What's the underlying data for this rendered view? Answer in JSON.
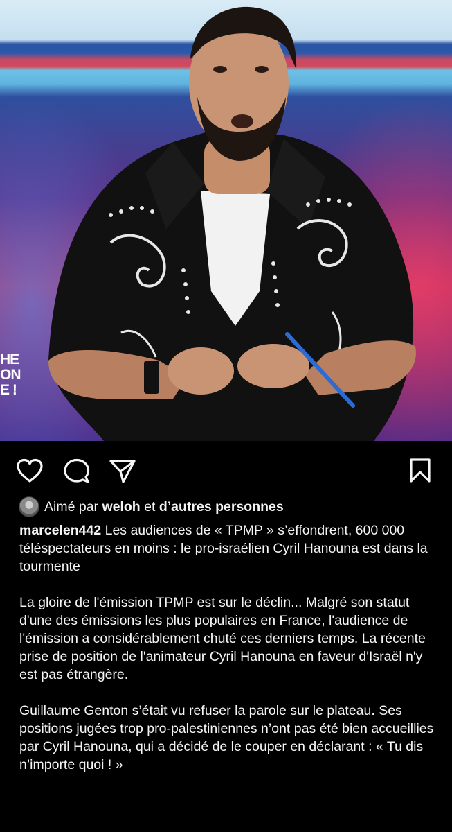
{
  "photo": {
    "logo_lines": [
      "HE",
      "ON",
      "E !"
    ]
  },
  "actions": {
    "like_icon": "heart-icon",
    "comment_icon": "comment-icon",
    "share_icon": "send-icon",
    "save_icon": "bookmark-icon"
  },
  "likes": {
    "prefix": "Aimé par",
    "user": "weloh",
    "connector": "et",
    "others": "d’autres personnes"
  },
  "caption": {
    "username": "marcelen442",
    "headline": "Les audiences de « TPMP » s’effondrent, 600 000 téléspectateurs en moins : le pro-israélien Cyril Hanouna est dans la tourmente",
    "paragraph_1": "La gloire de l'émission TPMP est sur le déclin... Malgré son statut d'une des émissions les plus populaires en France, l'audience de l'émission a considérablement chuté ces derniers temps. La récente prise de position de l'animateur Cyril Hanouna en faveur d'Israël n'y est pas étrangère.",
    "paragraph_2": "Guillaume Genton s’était vu refuser la parole sur le plateau. Ses positions jugées trop pro-palestiniennes n’ont pas été bien accueillies par Cyril Hanouna, qui a décidé de le couper en déclarant : « Tu dis n’importe quoi ! »"
  },
  "colors": {
    "background": "#000000",
    "text": "#f5f5f5"
  }
}
